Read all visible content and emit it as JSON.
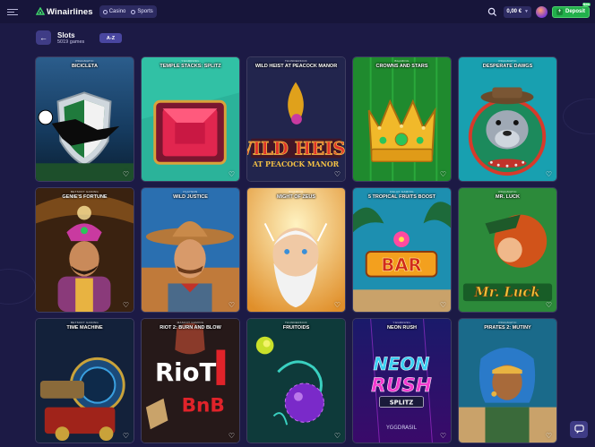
{
  "header": {
    "brand": "Winairlines",
    "nav": [
      {
        "label": "Casino",
        "icon": "casino-icon"
      },
      {
        "label": "Sports",
        "icon": "sports-icon"
      }
    ],
    "balance": "0,00 €",
    "deposit_label": "Deposit",
    "deposit_badge": "New"
  },
  "section": {
    "title": "Slots",
    "count": "5019 games",
    "sort_label": "A-Z"
  },
  "colors": {
    "background": "#1c1a45",
    "topbar": "#17153a",
    "deposit": "#22b04b",
    "accent": "#4946a0"
  },
  "games": [
    {
      "title": "BICICLETA",
      "provider": "PRAGMATIC"
    },
    {
      "title": "TEMPLE STACKS: SPLITZ",
      "provider": "YGGDRASIL"
    },
    {
      "title": "WILD HEIST AT PEACOCK MANOR",
      "provider": "THUNDERKICK"
    },
    {
      "title": "CROWNS AND STARS",
      "provider": "BGAMING"
    },
    {
      "title": "DESPERATE DAWGS",
      "provider": "PRAGMATIC"
    },
    {
      "title": "GENIE'S FORTUNE",
      "provider": "BETSOFT GAMING"
    },
    {
      "title": "WILD JUSTICE",
      "provider": "PLAYSON"
    },
    {
      "title": "MIGHT OF ZEUS",
      "provider": "BGAMING"
    },
    {
      "title": "5 TROPICAL FRUITS BOOST",
      "provider": "RELAX GAMING"
    },
    {
      "title": "MR. LUCK",
      "provider": "PRAGMATIC"
    },
    {
      "title": "TIME MACHINE",
      "provider": "BETSOFT GAMING"
    },
    {
      "title": "RIOT 2: BURN AND BLOW",
      "provider": "MASCOT GAMING"
    },
    {
      "title": "FRUITOIDS",
      "provider": "THUNDERKICK"
    },
    {
      "title": "NEON RUSH",
      "provider": "YGGDRASIL"
    },
    {
      "title": "PIRATES 2: MUTINY",
      "provider": "PRAGMATIC"
    }
  ],
  "art_text": {
    "wild_heist_line1": "WILD HEIST",
    "wild_heist_line2": "AT PEACOCK MANOR",
    "bar": "BAR",
    "mr_luck": "Mr. Luck",
    "riot": "RioT",
    "bnb": "BnB",
    "neon_line1": "NEON",
    "neon_line2": "RUSH",
    "splitz": "SPLITZ",
    "yggdrasil": "YGGDRASIL"
  }
}
